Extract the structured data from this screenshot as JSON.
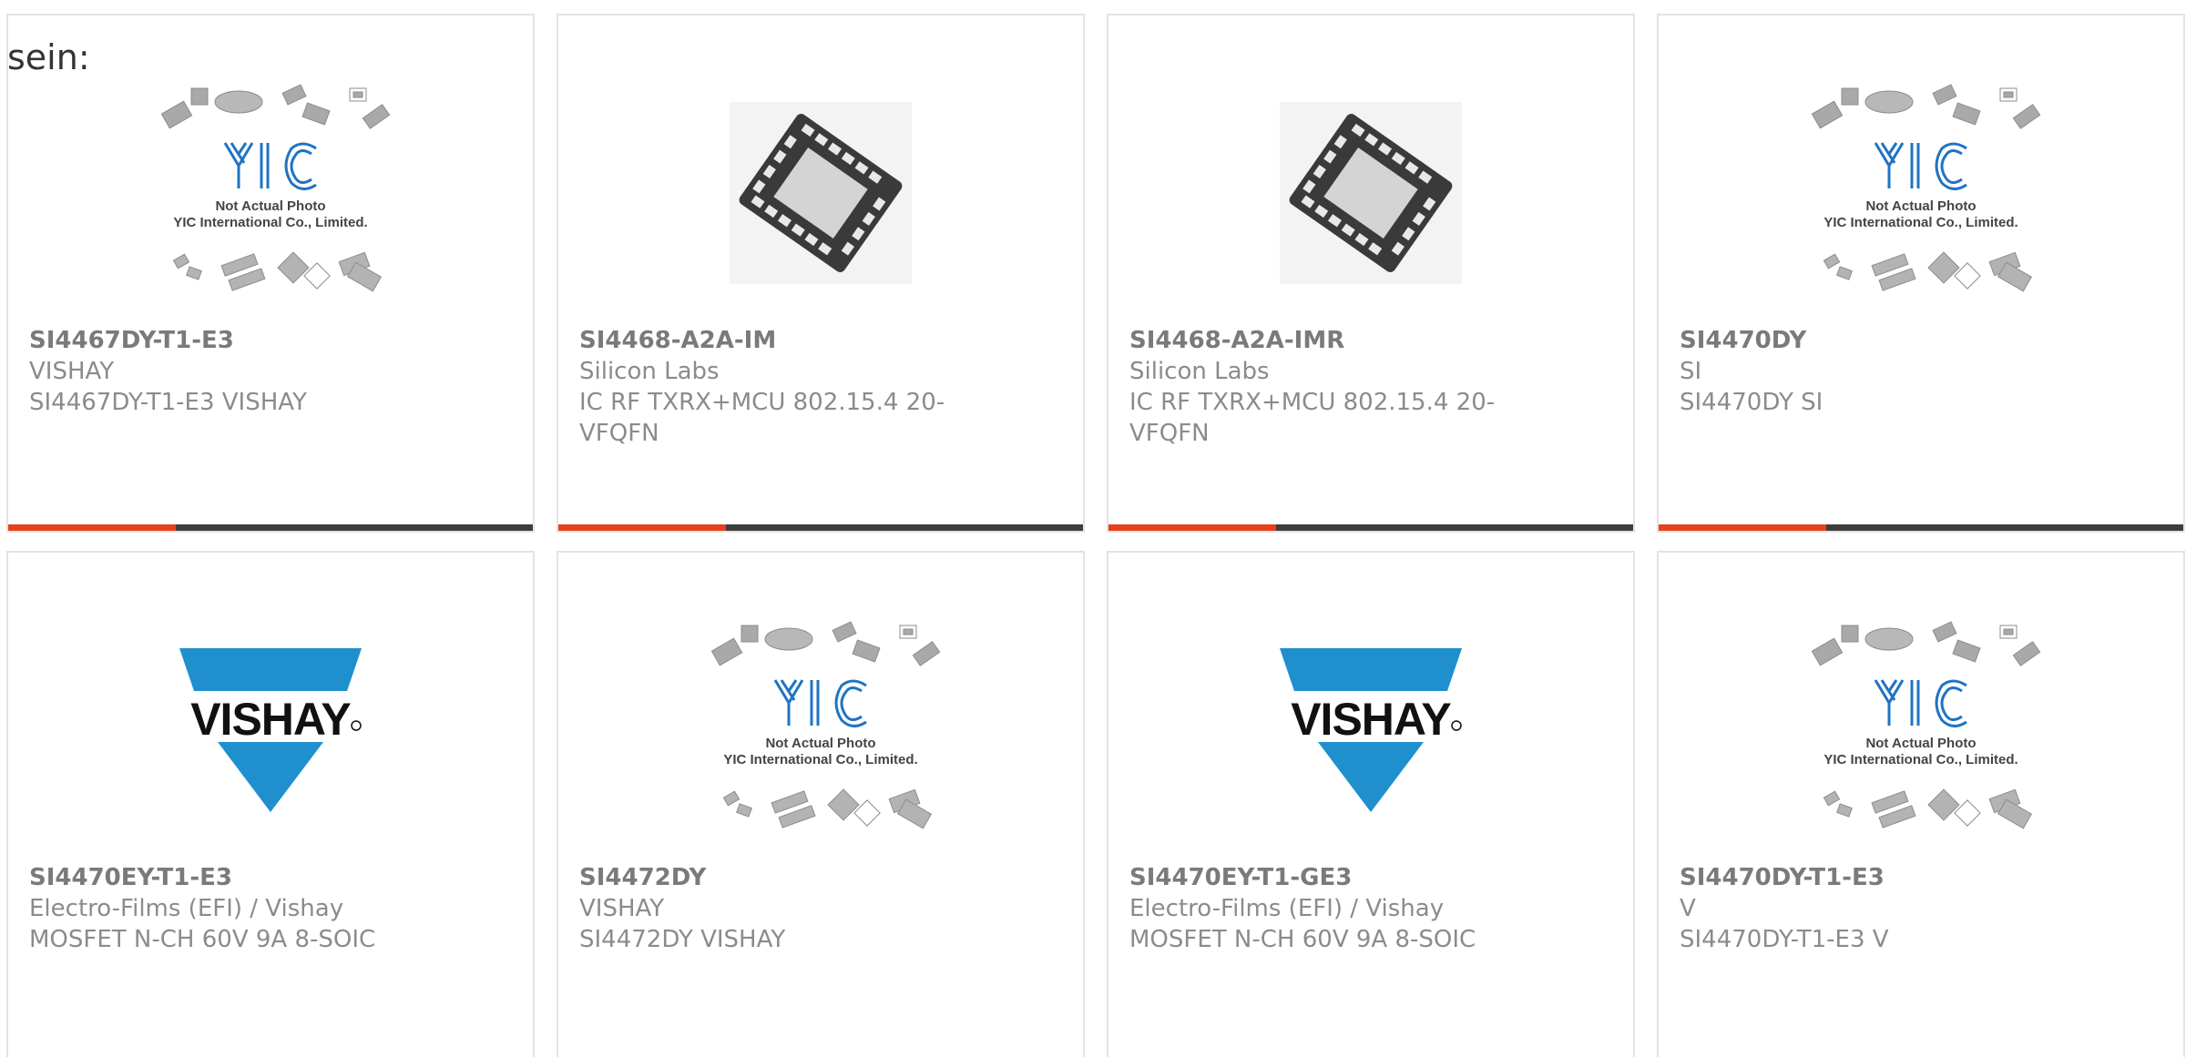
{
  "intro_text": "sein:",
  "colors": {
    "accent": "#e8401c",
    "bar": "#3d3d3d",
    "text": "#8b8b8b",
    "vishay_blue": "#1f8fce"
  },
  "placeholder": {
    "line1": "Not Actual Photo",
    "line2": "YIC International Co., Limited.",
    "logo_text": "YIC"
  },
  "vishay_logo": {
    "text": "VISHAY"
  },
  "products": [
    {
      "part": "SI4467DY-T1-E3",
      "manufacturer": "VISHAY",
      "description": "SI4467DY-T1-E3 VISHAY",
      "image": "yic-placeholder",
      "progress": 0.32
    },
    {
      "part": "SI4468-A2A-IM",
      "manufacturer": "Silicon Labs",
      "description": "IC RF TXRX+MCU 802.15.4 20-VFQFN",
      "image": "qfn-chip",
      "progress": 0.32
    },
    {
      "part": "SI4468-A2A-IMR",
      "manufacturer": "Silicon Labs",
      "description": "IC RF TXRX+MCU 802.15.4 20-VFQFN",
      "image": "qfn-chip",
      "progress": 0.32
    },
    {
      "part": "SI4470DY",
      "manufacturer": "SI",
      "description": "SI4470DY SI",
      "image": "yic-placeholder",
      "progress": 0.32
    },
    {
      "part": "SI4470EY-T1-E3",
      "manufacturer": "Electro-Films (EFI) / Vishay",
      "description": "MOSFET N-CH 60V 9A 8-SOIC",
      "image": "vishay-logo",
      "progress": 0
    },
    {
      "part": "SI4472DY",
      "manufacturer": "VISHAY",
      "description": "SI4472DY VISHAY",
      "image": "yic-placeholder",
      "progress": 0
    },
    {
      "part": "SI4470EY-T1-GE3",
      "manufacturer": "Electro-Films (EFI) / Vishay",
      "description": "MOSFET N-CH 60V 9A 8-SOIC",
      "image": "vishay-logo",
      "progress": 0
    },
    {
      "part": "SI4470DY-T1-E3",
      "manufacturer": "V",
      "description": "SI4470DY-T1-E3 V",
      "image": "yic-placeholder",
      "progress": 0
    }
  ]
}
